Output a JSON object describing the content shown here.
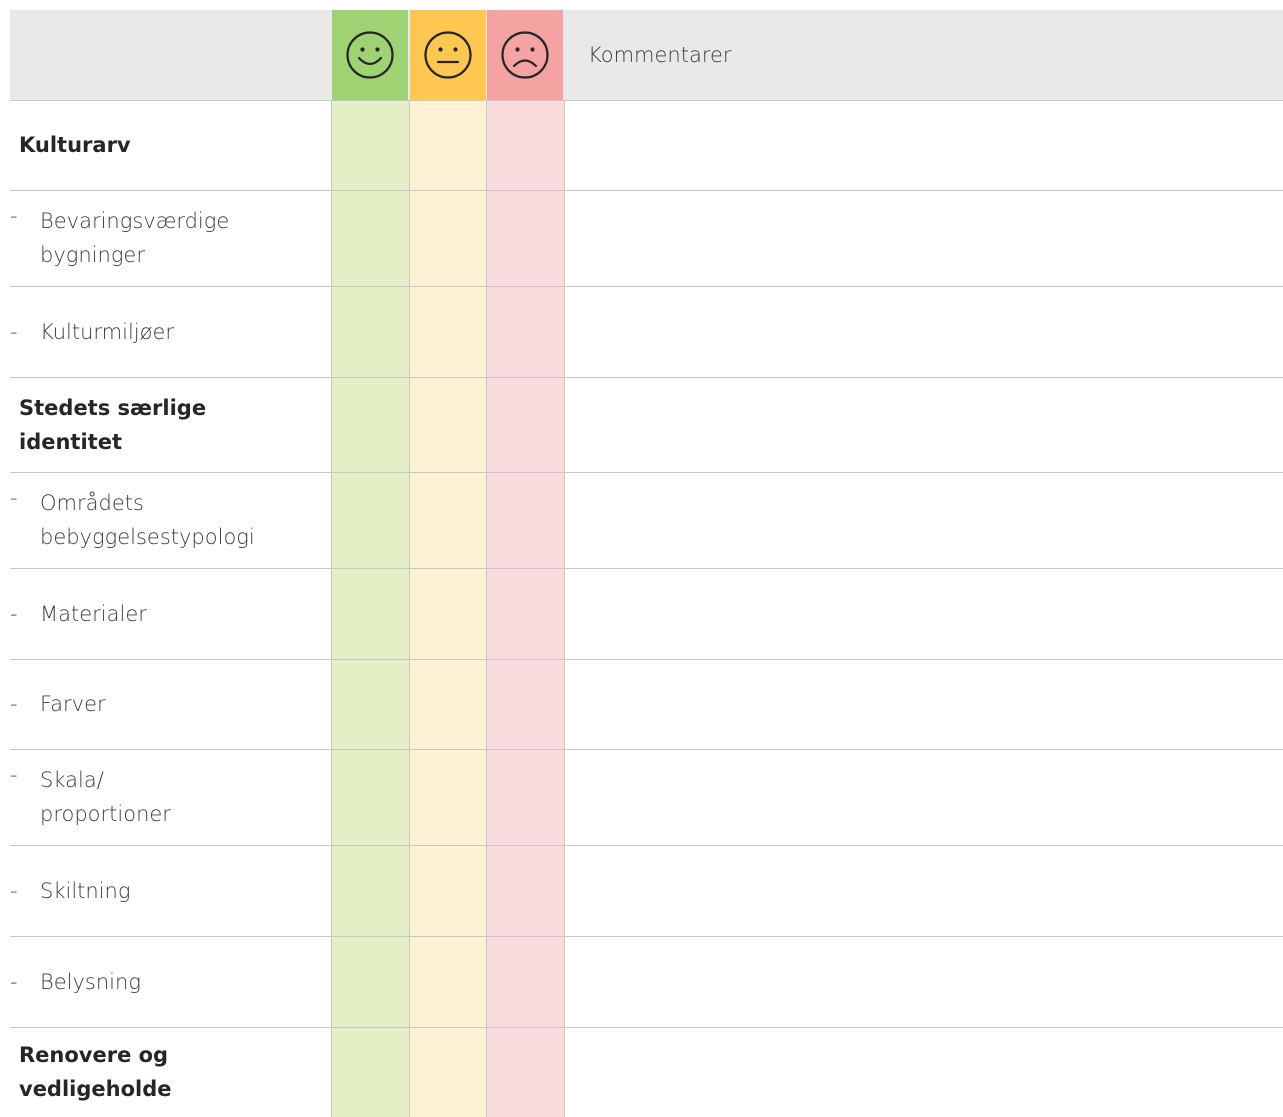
{
  "header": {
    "comments_label": "Kommentarer",
    "ratings": [
      {
        "name": "positive",
        "icon": "smiley-happy-icon",
        "color": "#9fd273",
        "column_color": "#e4efc5"
      },
      {
        "name": "neutral",
        "icon": "smiley-neutral-icon",
        "color": "#fdc752",
        "column_color": "#fdf1d3"
      },
      {
        "name": "negative",
        "icon": "smiley-sad-icon",
        "color": "#f4a2a2",
        "column_color": "#f9dadd"
      }
    ]
  },
  "rows": [
    {
      "label": "Kulturarv",
      "type": "heading"
    },
    {
      "label": "Bevaringsværdige bygninger",
      "type": "item"
    },
    {
      "label": "Kulturmiljøer",
      "type": "item"
    },
    {
      "label": "Stedets særlige identitet",
      "type": "heading"
    },
    {
      "label": "Områdets bebyggelsestypologi",
      "type": "item"
    },
    {
      "label": "Materialer",
      "type": "item"
    },
    {
      "label": "Farver",
      "type": "item"
    },
    {
      "label": "Skala/ proportioner",
      "type": "item"
    },
    {
      "label": "Skiltning",
      "type": "item"
    },
    {
      "label": "Belysning",
      "type": "item"
    },
    {
      "label": "Renovere og vedligeholde",
      "type": "heading"
    }
  ],
  "bullet": "-"
}
